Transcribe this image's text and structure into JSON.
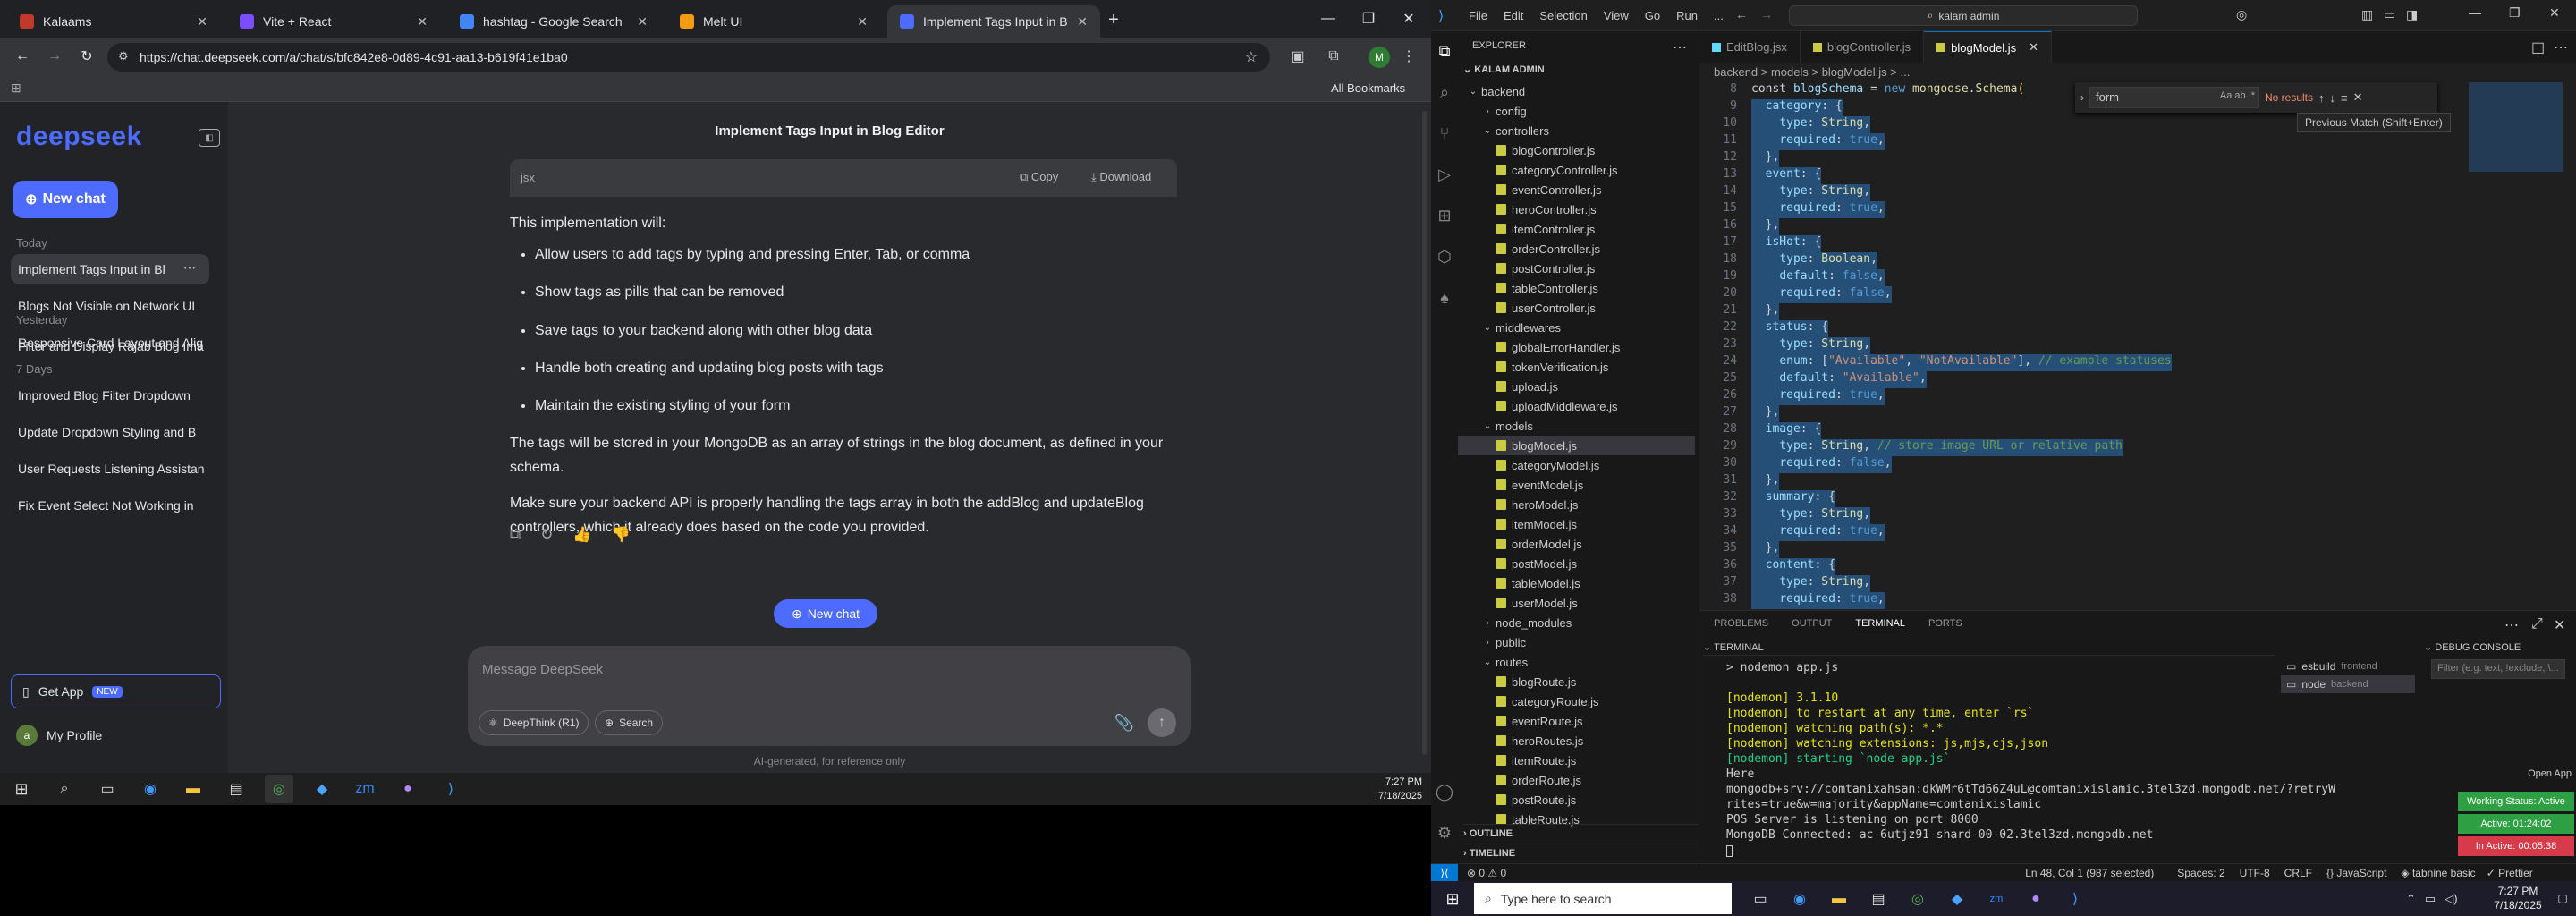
{
  "chrome": {
    "tabs": [
      {
        "title": "Kalaams",
        "color": "#c0392b"
      },
      {
        "title": "Vite + React",
        "color": "#7c4dff"
      },
      {
        "title": "hashtag - Google Search",
        "color": "#4285f4"
      },
      {
        "title": "Melt UI",
        "color": "#f39c12"
      },
      {
        "title": "Implement Tags Input in Blog E",
        "color": "#4d6bfe"
      }
    ],
    "url": "https://chat.deepseek.com/a/chat/s/bfc842e8-0d89-4c91-aa13-b619f41e1ba0",
    "all_bookmarks": "All Bookmarks"
  },
  "deepseek": {
    "logo": "deepseek",
    "new_chat": "New chat",
    "sections": [
      {
        "title": "Today",
        "items": [
          "Implement Tags Input in Bl",
          "Blogs Not Visible on Network UI",
          "Responsive Card Layout and Alig"
        ]
      },
      {
        "title": "Yesterday",
        "items": [
          "Filter and Display Rajab Blog Ima"
        ]
      },
      {
        "title": "7 Days",
        "items": [
          "Improved Blog Filter Dropdown",
          "Update Dropdown Styling and B",
          "User Requests Listening Assistan",
          "Fix Event Select Not Working in"
        ]
      }
    ],
    "get_app": "Get App",
    "new_badge": "NEW",
    "profile": "My Profile",
    "chat_title": "Implement Tags Input in Blog Editor",
    "code_lang": "jsx",
    "copy": "Copy",
    "download": "Download",
    "intro": "This implementation will:",
    "bullets": [
      "Allow users to add tags by typing and pressing Enter, Tab, or comma",
      "Show tags as pills that can be removed",
      "Save tags to your backend along with other blog data",
      "Handle both creating and updating blog posts with tags",
      "Maintain the existing styling of your form"
    ],
    "para1": "The tags will be stored in your MongoDB as an array of strings in the blog document, as defined in your schema.",
    "para2": "Make sure your backend API is properly handling the tags array in both the addBlog and updateBlog controllers, which it already does based on the code you provided.",
    "new_chat_mid": "New chat",
    "input_placeholder": "Message DeepSeek",
    "deepthink": "DeepThink (R1)",
    "search": "Search",
    "disclaimer": "AI-generated, for reference only"
  },
  "taskbar_left": {
    "time": "7:27 PM",
    "date": "7/18/2025"
  },
  "vscode": {
    "menu": [
      "File",
      "Edit",
      "Selection",
      "View",
      "Go",
      "Run",
      "..."
    ],
    "search_box": "kalam admin",
    "explorer_title": "EXPLORER",
    "root": "KALAM ADMIN",
    "tree": [
      {
        "d": 0,
        "t": "backend",
        "folder": true,
        "open": true
      },
      {
        "d": 1,
        "t": "config",
        "folder": true
      },
      {
        "d": 1,
        "t": "controllers",
        "folder": true,
        "open": true
      },
      {
        "d": 2,
        "t": "blogController.js"
      },
      {
        "d": 2,
        "t": "categoryController.js"
      },
      {
        "d": 2,
        "t": "eventController.js"
      },
      {
        "d": 2,
        "t": "heroController.js"
      },
      {
        "d": 2,
        "t": "itemController.js"
      },
      {
        "d": 2,
        "t": "orderController.js"
      },
      {
        "d": 2,
        "t": "postController.js"
      },
      {
        "d": 2,
        "t": "tableController.js"
      },
      {
        "d": 2,
        "t": "userController.js"
      },
      {
        "d": 1,
        "t": "middlewares",
        "folder": true,
        "open": true
      },
      {
        "d": 2,
        "t": "globalErrorHandler.js"
      },
      {
        "d": 2,
        "t": "tokenVerification.js"
      },
      {
        "d": 2,
        "t": "upload.js"
      },
      {
        "d": 2,
        "t": "uploadMiddleware.js"
      },
      {
        "d": 1,
        "t": "models",
        "folder": true,
        "open": true
      },
      {
        "d": 2,
        "t": "blogModel.js",
        "sel": true
      },
      {
        "d": 2,
        "t": "categoryModel.js"
      },
      {
        "d": 2,
        "t": "eventModel.js"
      },
      {
        "d": 2,
        "t": "heroModel.js"
      },
      {
        "d": 2,
        "t": "itemModel.js"
      },
      {
        "d": 2,
        "t": "orderModel.js"
      },
      {
        "d": 2,
        "t": "postModel.js"
      },
      {
        "d": 2,
        "t": "tableModel.js"
      },
      {
        "d": 2,
        "t": "userModel.js"
      },
      {
        "d": 1,
        "t": "node_modules",
        "folder": true
      },
      {
        "d": 1,
        "t": "public",
        "folder": true
      },
      {
        "d": 1,
        "t": "routes",
        "folder": true,
        "open": true
      },
      {
        "d": 2,
        "t": "blogRoute.js"
      },
      {
        "d": 2,
        "t": "categoryRoute.js"
      },
      {
        "d": 2,
        "t": "eventRoute.js"
      },
      {
        "d": 2,
        "t": "heroRoutes.js"
      },
      {
        "d": 2,
        "t": "itemRoute.js"
      },
      {
        "d": 2,
        "t": "orderRoute.js"
      },
      {
        "d": 2,
        "t": "postRoute.js"
      },
      {
        "d": 2,
        "t": "tableRoute.js"
      }
    ],
    "outline": "OUTLINE",
    "timeline": "TIMELINE",
    "editor_tabs": [
      "EditBlog.jsx",
      "blogController.js",
      "blogModel.js"
    ],
    "breadcrumb": "backend > models > blogModel.js > ...",
    "find_value": "form",
    "find_result": "No results",
    "find_tooltip": "Previous Match (Shift+Enter)",
    "code": [
      {
        "n": "8",
        "h": [
          [
            "p",
            "const "
          ],
          [
            "k",
            "blogSchema"
          ],
          [
            "p",
            " = "
          ],
          [
            "b",
            "new "
          ],
          [
            "f",
            "mongoose"
          ],
          [
            "p",
            "."
          ],
          [
            "f",
            "Schema"
          ],
          [
            "y",
            "("
          ]
        ]
      },
      {
        "n": "9",
        "h": [
          [
            "p",
            "  "
          ],
          [
            "k",
            "category"
          ],
          [
            "p",
            ": {"
          ]
        ]
      },
      {
        "n": "10",
        "h": [
          [
            "p",
            "    "
          ],
          [
            "k",
            "type"
          ],
          [
            "p",
            ": "
          ],
          [
            "f",
            "String"
          ],
          [
            "p",
            ","
          ]
        ]
      },
      {
        "n": "11",
        "h": [
          [
            "p",
            "    "
          ],
          [
            "k",
            "required"
          ],
          [
            "p",
            ": "
          ],
          [
            "b",
            "true"
          ],
          [
            "p",
            ","
          ]
        ]
      },
      {
        "n": "12",
        "h": [
          [
            "p",
            "  },"
          ]
        ]
      },
      {
        "n": "13",
        "h": [
          [
            "p",
            "  "
          ],
          [
            "k",
            "event"
          ],
          [
            "p",
            ": {"
          ]
        ]
      },
      {
        "n": "14",
        "h": [
          [
            "p",
            "    "
          ],
          [
            "k",
            "type"
          ],
          [
            "p",
            ": "
          ],
          [
            "f",
            "String"
          ],
          [
            "p",
            ","
          ]
        ]
      },
      {
        "n": "15",
        "h": [
          [
            "p",
            "    "
          ],
          [
            "k",
            "required"
          ],
          [
            "p",
            ": "
          ],
          [
            "b",
            "true"
          ],
          [
            "p",
            ","
          ]
        ]
      },
      {
        "n": "16",
        "h": [
          [
            "p",
            "  },"
          ]
        ]
      },
      {
        "n": "17",
        "h": [
          [
            "p",
            "  "
          ],
          [
            "k",
            "isHot"
          ],
          [
            "p",
            ": {"
          ]
        ]
      },
      {
        "n": "18",
        "h": [
          [
            "p",
            "    "
          ],
          [
            "k",
            "type"
          ],
          [
            "p",
            ": "
          ],
          [
            "f",
            "Boolean"
          ],
          [
            "p",
            ","
          ]
        ]
      },
      {
        "n": "19",
        "h": [
          [
            "p",
            "    "
          ],
          [
            "k",
            "default"
          ],
          [
            "p",
            ": "
          ],
          [
            "b",
            "false"
          ],
          [
            "p",
            ","
          ]
        ]
      },
      {
        "n": "20",
        "h": [
          [
            "p",
            "    "
          ],
          [
            "k",
            "required"
          ],
          [
            "p",
            ": "
          ],
          [
            "b",
            "false"
          ],
          [
            "p",
            ","
          ]
        ]
      },
      {
        "n": "21",
        "h": [
          [
            "p",
            "  },"
          ]
        ]
      },
      {
        "n": "22",
        "h": [
          [
            "p",
            "  "
          ],
          [
            "k",
            "status"
          ],
          [
            "p",
            ": {"
          ]
        ]
      },
      {
        "n": "23",
        "h": [
          [
            "p",
            "    "
          ],
          [
            "k",
            "type"
          ],
          [
            "p",
            ": "
          ],
          [
            "f",
            "String"
          ],
          [
            "p",
            ","
          ]
        ]
      },
      {
        "n": "24",
        "h": [
          [
            "p",
            "    "
          ],
          [
            "k",
            "enum"
          ],
          [
            "p",
            ": ["
          ],
          [
            "s",
            "\"Available\""
          ],
          [
            "p",
            ", "
          ],
          [
            "s",
            "\"NotAvailable\""
          ],
          [
            "p",
            "], "
          ],
          [
            "c",
            "// example statuses"
          ]
        ]
      },
      {
        "n": "25",
        "h": [
          [
            "p",
            "    "
          ],
          [
            "k",
            "default"
          ],
          [
            "p",
            ": "
          ],
          [
            "s",
            "\"Available\""
          ],
          [
            "p",
            ","
          ]
        ]
      },
      {
        "n": "26",
        "h": [
          [
            "p",
            "    "
          ],
          [
            "k",
            "required"
          ],
          [
            "p",
            ": "
          ],
          [
            "b",
            "true"
          ],
          [
            "p",
            ","
          ]
        ]
      },
      {
        "n": "27",
        "h": [
          [
            "p",
            "  },"
          ]
        ]
      },
      {
        "n": "28",
        "h": [
          [
            "p",
            "  "
          ],
          [
            "k",
            "image"
          ],
          [
            "p",
            ": {"
          ]
        ]
      },
      {
        "n": "29",
        "h": [
          [
            "p",
            "    "
          ],
          [
            "k",
            "type"
          ],
          [
            "p",
            ": "
          ],
          [
            "f",
            "String"
          ],
          [
            "p",
            ", "
          ],
          [
            "c",
            "// store image URL or relative path"
          ]
        ]
      },
      {
        "n": "30",
        "h": [
          [
            "p",
            "    "
          ],
          [
            "k",
            "required"
          ],
          [
            "p",
            ": "
          ],
          [
            "b",
            "false"
          ],
          [
            "p",
            ","
          ]
        ]
      },
      {
        "n": "31",
        "h": [
          [
            "p",
            "  },"
          ]
        ]
      },
      {
        "n": "32",
        "h": [
          [
            "p",
            "  "
          ],
          [
            "k",
            "summary"
          ],
          [
            "p",
            ": {"
          ]
        ]
      },
      {
        "n": "33",
        "h": [
          [
            "p",
            "    "
          ],
          [
            "k",
            "type"
          ],
          [
            "p",
            ": "
          ],
          [
            "f",
            "String"
          ],
          [
            "p",
            ","
          ]
        ]
      },
      {
        "n": "34",
        "h": [
          [
            "p",
            "    "
          ],
          [
            "k",
            "required"
          ],
          [
            "p",
            ": "
          ],
          [
            "b",
            "true"
          ],
          [
            "p",
            ","
          ]
        ]
      },
      {
        "n": "35",
        "h": [
          [
            "p",
            "  },"
          ]
        ]
      },
      {
        "n": "36",
        "h": [
          [
            "p",
            "  "
          ],
          [
            "k",
            "content"
          ],
          [
            "p",
            ": {"
          ]
        ]
      },
      {
        "n": "37",
        "h": [
          [
            "p",
            "    "
          ],
          [
            "k",
            "type"
          ],
          [
            "p",
            ": "
          ],
          [
            "f",
            "String"
          ],
          [
            "p",
            ","
          ]
        ]
      },
      {
        "n": "38",
        "h": [
          [
            "p",
            "    "
          ],
          [
            "k",
            "required"
          ],
          [
            "p",
            ": "
          ],
          [
            "b",
            "true"
          ],
          [
            "p",
            ","
          ]
        ]
      }
    ],
    "panel_tabs": [
      "PROBLEMS",
      "OUTPUT",
      "TERMINAL",
      "PORTS"
    ],
    "terminal_label": "TERMINAL",
    "terminal_lines": [
      {
        "t": "> nodemon app.js",
        "c": "#ccc"
      },
      {
        "t": "",
        "c": "#ccc"
      },
      {
        "t": "[nodemon] 3.1.10",
        "c": "#e5e510"
      },
      {
        "t": "[nodemon] to restart at any time, enter `rs`",
        "c": "#e5e510"
      },
      {
        "t": "[nodemon] watching path(s): *.*",
        "c": "#e5e510"
      },
      {
        "t": "[nodemon] watching extensions: js,mjs,cjs,json",
        "c": "#e5e510"
      },
      {
        "t": "[nodemon] starting `node app.js`",
        "c": "#23d18b"
      },
      {
        "t": "Here",
        "c": "#ccc"
      },
      {
        "t": "mongodb+srv://comtanixahsan:dkWMr6tTd66Z4uL@comtanixislamic.3tel3zd.mongodb.net/?retryW",
        "c": "#ccc"
      },
      {
        "t": "rites=true&w=majority&appName=comtanixislamic",
        "c": "#ccc"
      },
      {
        "t": "POS Server is listening on port 8000",
        "c": "#ccc"
      },
      {
        "t": "MongoDB Connected: ac-6utjz91-shard-00-02.3tel3zd.mongodb.net",
        "c": "#ccc"
      }
    ],
    "term_sessions": [
      {
        "name": "esbuild",
        "sub": "frontend"
      },
      {
        "name": "node",
        "sub": "backend"
      }
    ],
    "debug_console": "DEBUG CONSOLE",
    "debug_filter": "Filter (e.g. text, !exclude, \\...",
    "open_app": "Open App",
    "status_pills": [
      {
        "t": "Working Status: Active",
        "c": "#2ea043"
      },
      {
        "t": "Active: 01:24:02",
        "c": "#2ea043"
      },
      {
        "t": "In Active: 00:05:38",
        "c": "#d73a49"
      }
    ],
    "statusbar": {
      "errors": "0",
      "warnings": "0",
      "pos": "Ln 48, Col 1 (987 selected)",
      "spaces": "Spaces: 2",
      "enc": "UTF-8",
      "eol": "CRLF",
      "lang": "JavaScript",
      "tabnine": "tabnine basic",
      "prettier": "Prettier"
    }
  },
  "win_taskbar": {
    "search": "Type here to search",
    "time": "7:27 PM",
    "date": "7/18/2025"
  }
}
